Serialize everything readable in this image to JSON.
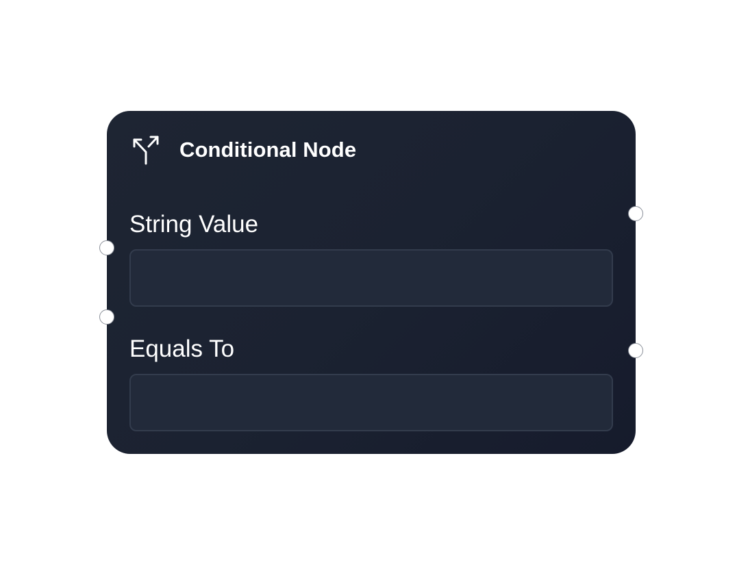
{
  "node": {
    "title": "Conditional Node",
    "icon": "split-arrow-icon",
    "fields": [
      {
        "label": "String Value",
        "value": "",
        "placeholder": ""
      },
      {
        "label": "Equals To",
        "value": "",
        "placeholder": ""
      }
    ]
  },
  "colors": {
    "node_background": "#1b2231",
    "input_background": "#222a3a",
    "input_border": "#333c4d",
    "text": "#ffffff",
    "handle": "#ffffff"
  }
}
